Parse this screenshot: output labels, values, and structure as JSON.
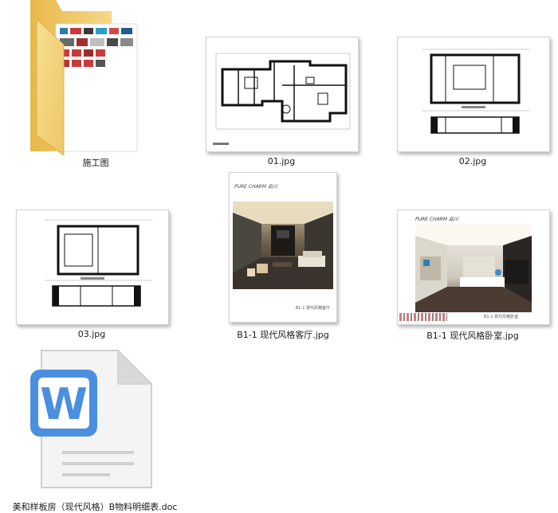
{
  "files": [
    {
      "name": "施工图",
      "type": "folder",
      "icon": "folder-icon"
    },
    {
      "name": "01.jpg",
      "type": "image",
      "icon": "floorplan-thumbnail"
    },
    {
      "name": "02.jpg",
      "type": "image",
      "icon": "floorplan-thumbnail"
    },
    {
      "name": "03.jpg",
      "type": "image",
      "icon": "floorplan-thumbnail"
    },
    {
      "name": "B1-1  现代风格客厅.jpg",
      "type": "image",
      "icon": "living-room-render-thumbnail"
    },
    {
      "name": "B1-1  现代风格卧室.jpg",
      "type": "image",
      "icon": "bedroom-render-thumbnail"
    },
    {
      "name": "美和样板房（现代风格）B物料明细表.doc",
      "type": "document",
      "icon": "word-document-icon"
    }
  ],
  "brand_text": "PURE CHARM 品川",
  "caption_living": "B1-1  现代风格客厅",
  "caption_bedroom": "B1-1  现代风格卧室",
  "word_letter": "W",
  "colors": {
    "word_blue": "#4a8fe0",
    "folder_yellow": "#f2cf6a"
  }
}
